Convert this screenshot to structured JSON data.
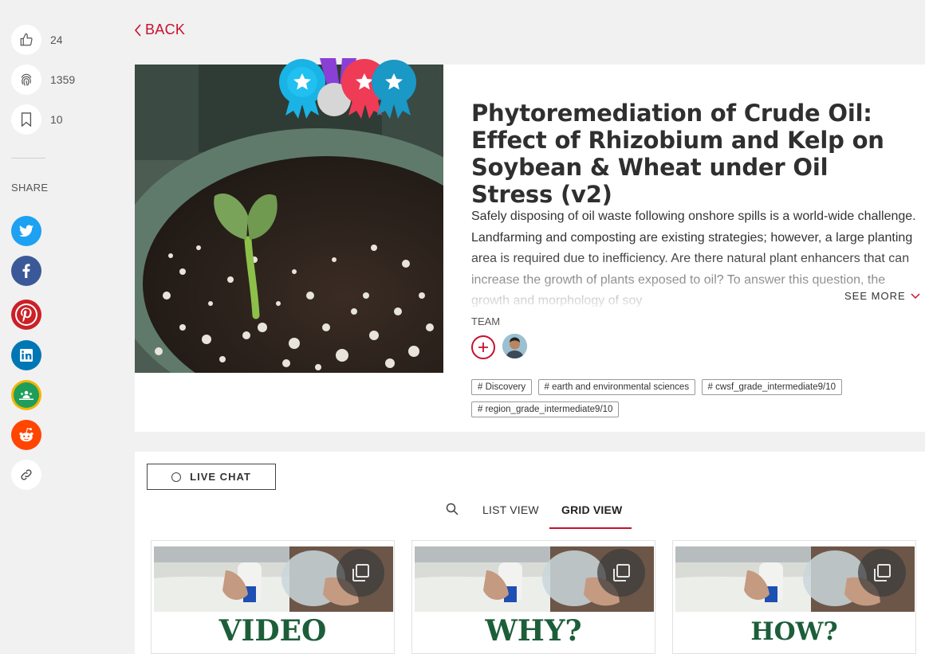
{
  "stats": {
    "likes": "24",
    "views": "1359",
    "saves": "10"
  },
  "share": {
    "label": "SHARE"
  },
  "nav": {
    "back_label": "BACK"
  },
  "project": {
    "title": "Phytoremediation of Crude Oil: Effect of Rhizobium and Kelp on Soybean & Wheat under Oil Stress (v2)",
    "description": "Safely disposing of oil waste following onshore spills is a world-wide challenge. Landfarming and composting are existing strategies; however, a large planting area is required due to inefficiency. Are there natural plant enhancers that can increase the growth of plants exposed to oil? To answer this question, the growth and morphology of soy",
    "see_more": "SEE MORE",
    "team_label": "TEAM",
    "tags": [
      "# Discovery",
      "# earth and environmental sciences",
      "# cwsf_grade_intermediate9/10",
      "# region_grade_intermediate9/10"
    ]
  },
  "chat": {
    "live_chat_label": "LIVE CHAT"
  },
  "views": {
    "list": "LIST VIEW",
    "grid": "GRID VIEW"
  },
  "cards": [
    {
      "caption": "VIDEO"
    },
    {
      "caption": "WHY?"
    },
    {
      "caption": "HOW?"
    }
  ],
  "colors": {
    "accent": "#c8102e",
    "twitter": "#1da1f2",
    "facebook": "#3b5998",
    "pinterest": "#cb2027",
    "linkedin": "#0077b5",
    "classroom": "#1e9e5a",
    "reddit": "#ff4500"
  }
}
